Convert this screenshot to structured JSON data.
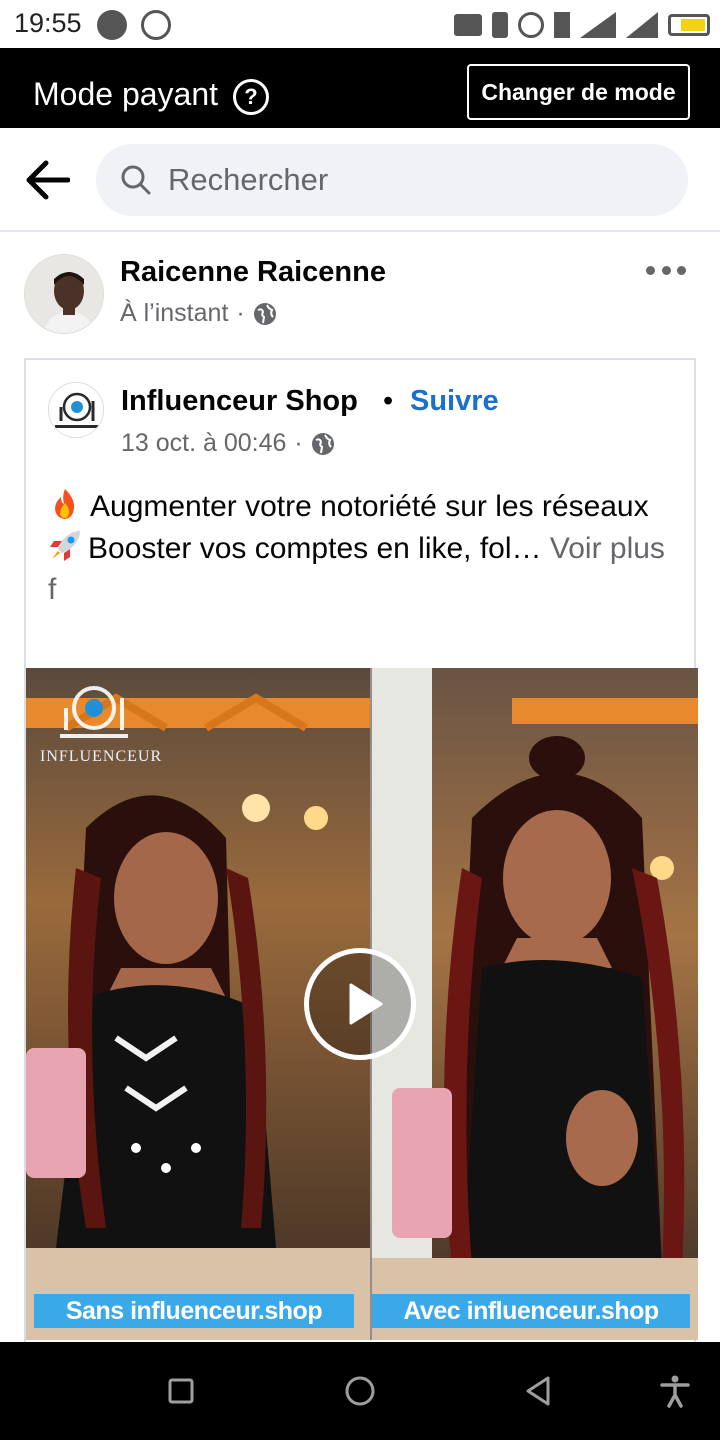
{
  "status_bar": {
    "time": "19:55",
    "battery_color": "#f5d20f",
    "icons": [
      "music-icon",
      "whatsapp-icon",
      "cast-icon",
      "vibrate-icon",
      "alarm-icon",
      "data-icon",
      "signal-icon",
      "signal-icon",
      "battery-icon"
    ]
  },
  "mode_bar": {
    "title": "Mode payant",
    "help_icon": "?",
    "button_label": "Changer de mode"
  },
  "search": {
    "placeholder": "Rechercher"
  },
  "post": {
    "author": "Raicenne Raicenne",
    "time": "À l’instant",
    "separator": "·",
    "shared": {
      "page_name": "Influenceur Shop",
      "dot": "•",
      "follow_label": "Suivre",
      "date": "13 oct. à 00:46",
      "separator": "·",
      "text_line1": "Augmenter votre notoriété sur les réseaux",
      "text_line2": "Booster vos comptes en like, fol…",
      "see_more": " Voir plus f",
      "video": {
        "watermark": "INFLUENCEUR",
        "caption_left": "Sans influenceur.shop",
        "caption_right": "Avec influenceur.shop"
      }
    }
  },
  "colors": {
    "link_blue": "#1b6fd1",
    "caption_blue": "#3ba8e8",
    "mode_bar_bg": "#000000"
  }
}
